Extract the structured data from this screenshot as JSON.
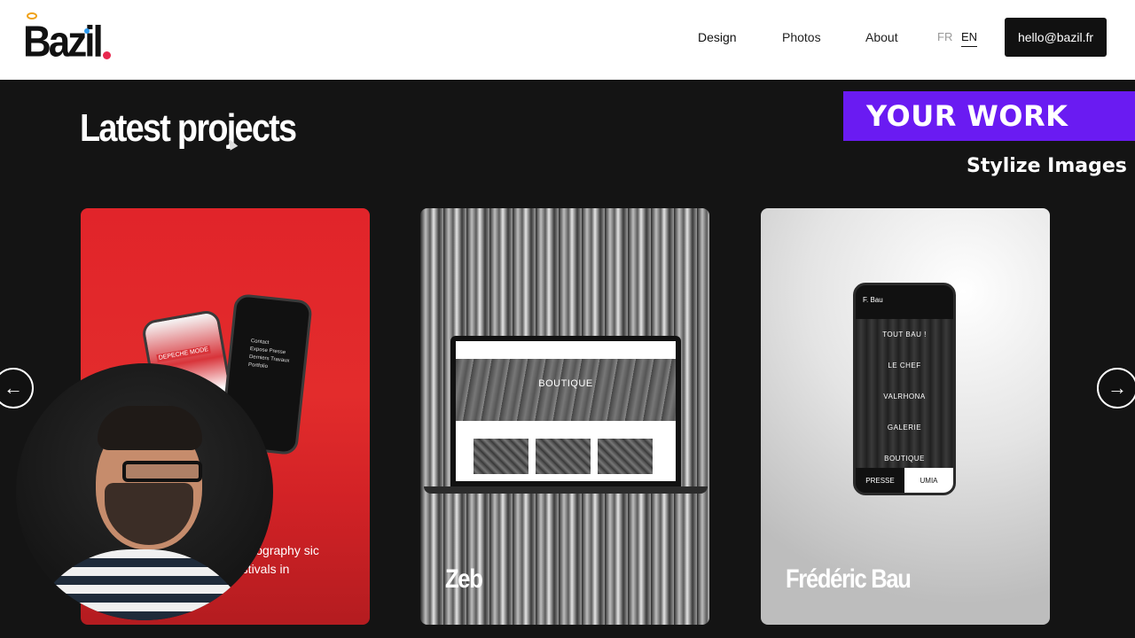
{
  "brand": {
    "logo_text": "Bazil"
  },
  "nav": {
    "items": [
      {
        "label": "Design"
      },
      {
        "label": "Photos"
      },
      {
        "label": "About"
      }
    ],
    "languages": [
      {
        "label": "FR"
      },
      {
        "label": "EN"
      }
    ],
    "contact_email": "hello@bazil.fr"
  },
  "section": {
    "title": "Latest projects"
  },
  "promo": {
    "banner": "YOUR WORK",
    "subtitle": "Stylize Images"
  },
  "projects": [
    {
      "title": "",
      "description": "photography sic festivals in",
      "accent": "#e1242a",
      "phone_text": [
        "Contact",
        "Expose Presse",
        "Derniers Travaux",
        "Portfolio"
      ],
      "phone_label": "DEPECHE MODE"
    },
    {
      "title": "Zeb",
      "screen_title": "BOUTIQUE"
    },
    {
      "title": "Frédéric Bau",
      "phone_brand": "F. Bau",
      "menu": [
        "TOUT BAU !",
        "LE CHEF",
        "VALRHONA",
        "GALERIE",
        "BOUTIQUE"
      ],
      "bottom_left": "PRESSE",
      "bottom_right": "UMIA"
    }
  ],
  "colors": {
    "promo_purple": "#6a1bf2",
    "logo_dot": "#e8284f",
    "background": "#141414"
  }
}
